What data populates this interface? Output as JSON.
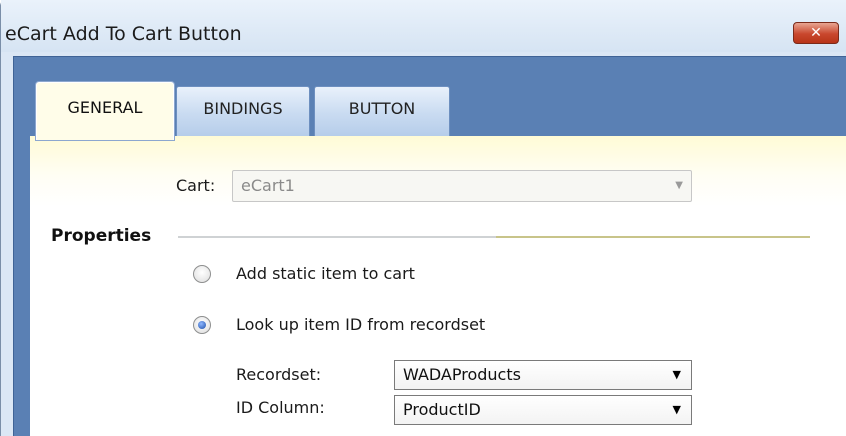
{
  "window": {
    "title": "eCart Add To Cart Button",
    "close_glyph": "✕"
  },
  "tabs": [
    {
      "label": "GENERAL",
      "active": true
    },
    {
      "label": "BINDINGS",
      "active": false
    },
    {
      "label": "BUTTON",
      "active": false
    }
  ],
  "general": {
    "cart_label": "Cart:",
    "cart_value": "eCart1",
    "properties_heading": "Properties",
    "options": [
      {
        "label": "Add static item to cart",
        "selected": false
      },
      {
        "label": "Look up item ID from recordset",
        "selected": true
      }
    ],
    "recordset_label": "Recordset:",
    "recordset_value": "WADAProducts",
    "id_column_label": "ID Column:",
    "id_column_value": "ProductID"
  },
  "icons": {
    "dropdown_arrow": "▼"
  },
  "colors": {
    "tab_active_bg": "#fffde9",
    "frame_blue": "#5a80b4",
    "close_red": "#c9472d"
  }
}
